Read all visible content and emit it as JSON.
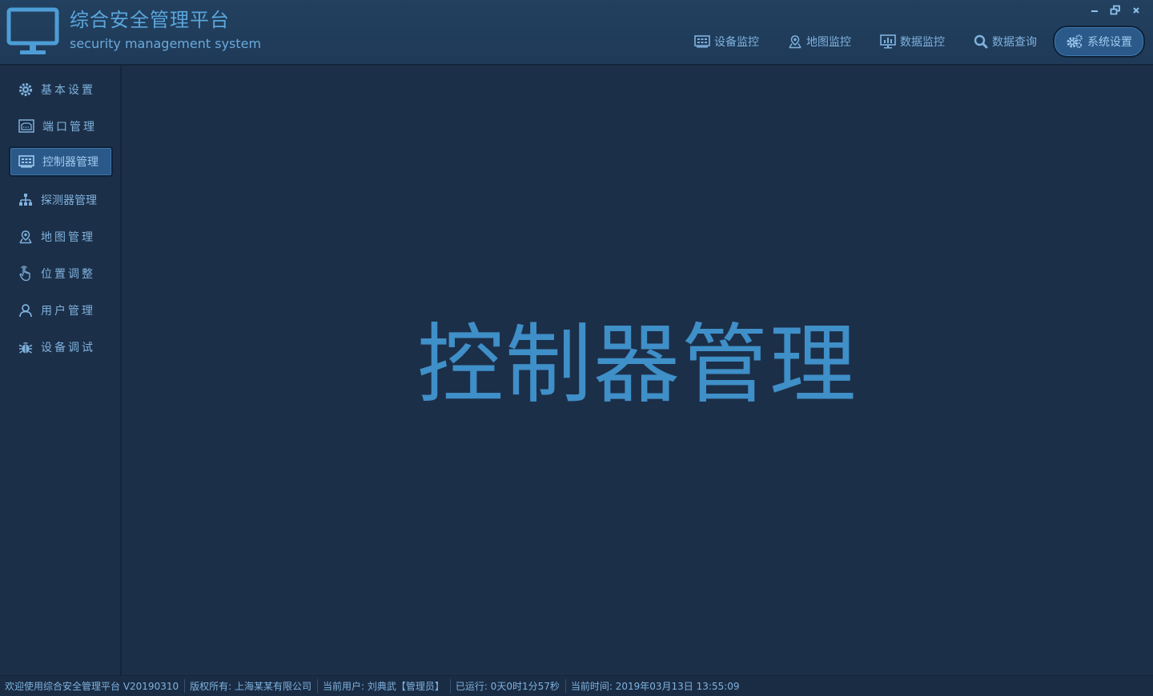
{
  "app": {
    "title": "综合安全管理平台",
    "subtitle": "security management system"
  },
  "window_controls": [
    "minimize-icon",
    "restore-icon",
    "close-icon"
  ],
  "nav": {
    "items": [
      {
        "label": "设备监控",
        "icon": "device-grid-icon"
      },
      {
        "label": "地图监控",
        "icon": "map-pin-icon"
      },
      {
        "label": "数据监控",
        "icon": "monitor-chart-icon"
      },
      {
        "label": "数据查询",
        "icon": "search-icon"
      },
      {
        "label": "系统设置",
        "icon": "gears-icon",
        "active": true
      }
    ]
  },
  "sidebar": {
    "items": [
      {
        "label": "基本设置",
        "icon": "gear-icon"
      },
      {
        "label": "端口管理",
        "icon": "port-icon"
      },
      {
        "label": "控制器管理",
        "icon": "controller-icon",
        "active": true
      },
      {
        "label": "探测器管理",
        "icon": "hierarchy-icon"
      },
      {
        "label": "地图管理",
        "icon": "map-pin-icon"
      },
      {
        "label": "位置调整",
        "icon": "hand-pointer-icon"
      },
      {
        "label": "用户管理",
        "icon": "user-icon"
      },
      {
        "label": "设备调试",
        "icon": "bug-icon"
      }
    ]
  },
  "main": {
    "heading": "控制器管理"
  },
  "status": {
    "welcome": "欢迎使用综合安全管理平台 V20190310",
    "copyright": "版权所有: 上海某某有限公司",
    "current_user": "当前用户: 刘典武【管理员】",
    "uptime": "已运行: 0天0时1分57秒",
    "current_time": "当前时间: 2019年03月13日 13:55:09"
  },
  "colors": {
    "background": "#1c2f48",
    "header": "#22405f",
    "accent": "#3f8fc8",
    "active": "#2a5888",
    "text": "#7fb2de"
  }
}
